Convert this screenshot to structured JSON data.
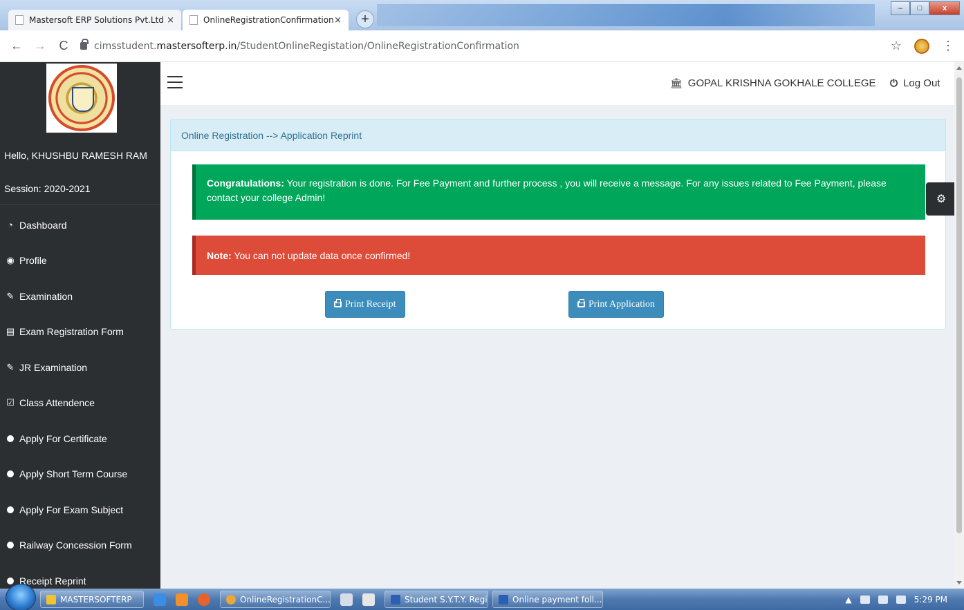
{
  "browser": {
    "tabs": [
      {
        "title": "Mastersoft ERP Solutions Pvt.Ltd",
        "close": "×"
      },
      {
        "title": "OnlineRegistrationConfirmation",
        "close": "×"
      }
    ],
    "new_tab": "+",
    "url_host": "cimsstudent.",
    "url_main": "mastersofterp.in",
    "url_path": "/StudentOnlineRegistation/OnlineRegistrationConfirmation",
    "window_controls": {
      "minimize": "–",
      "maximize": "□",
      "close": "x"
    }
  },
  "sidebar": {
    "greeting": "Hello, KHUSHBU RAMESH RAM",
    "session": "Session: 2020-2021",
    "items": [
      {
        "label": "Dashboard",
        "icon": "dashboard-icon"
      },
      {
        "label": "Profile",
        "icon": "user-circle-icon"
      },
      {
        "label": "Examination",
        "icon": "pencil-icon"
      },
      {
        "label": "Exam Registration Form",
        "icon": "pdf-file-icon"
      },
      {
        "label": "JR Examination",
        "icon": "pencil-icon"
      },
      {
        "label": "Class Attendence",
        "icon": "checkbox-icon"
      },
      {
        "label": "Apply For Certificate",
        "icon": "circle-icon"
      },
      {
        "label": "Apply Short Term Course",
        "icon": "circle-icon"
      },
      {
        "label": "Apply For Exam Subject",
        "icon": "circle-icon"
      },
      {
        "label": "Railway Concession Form",
        "icon": "circle-icon"
      },
      {
        "label": "Receipt Reprint",
        "icon": "circle-icon"
      }
    ]
  },
  "header": {
    "college": "GOPAL KRISHNA GOKHALE COLLEGE",
    "logout": "Log Out"
  },
  "panel": {
    "breadcrumb": "Online Registration --> Application Reprint",
    "success_strong": "Congratulations:",
    "success_text": " Your registration is done. For Fee Payment and further process , you will receive a message. For any issues related to Fee Payment, please contact your college Admin!",
    "note_strong": "Note:",
    "note_text": " You can not update data once confirmed!",
    "print_receipt": "Print Receipt",
    "print_application": "Print Application"
  },
  "taskbar": {
    "items": [
      {
        "label": "MASTERSOFTERP"
      },
      {
        "label": "OnlineRegistrationC..."
      },
      {
        "label": "Student S.Y.T.Y. Regi..."
      },
      {
        "label": "Online payment foll..."
      }
    ],
    "clock": "5:29 PM"
  },
  "colors": {
    "sidebar_bg": "#2c2f32",
    "success": "#00a65a",
    "danger": "#dd4b39",
    "primary": "#3c8dbc",
    "panel_head": "#d9edf7"
  }
}
